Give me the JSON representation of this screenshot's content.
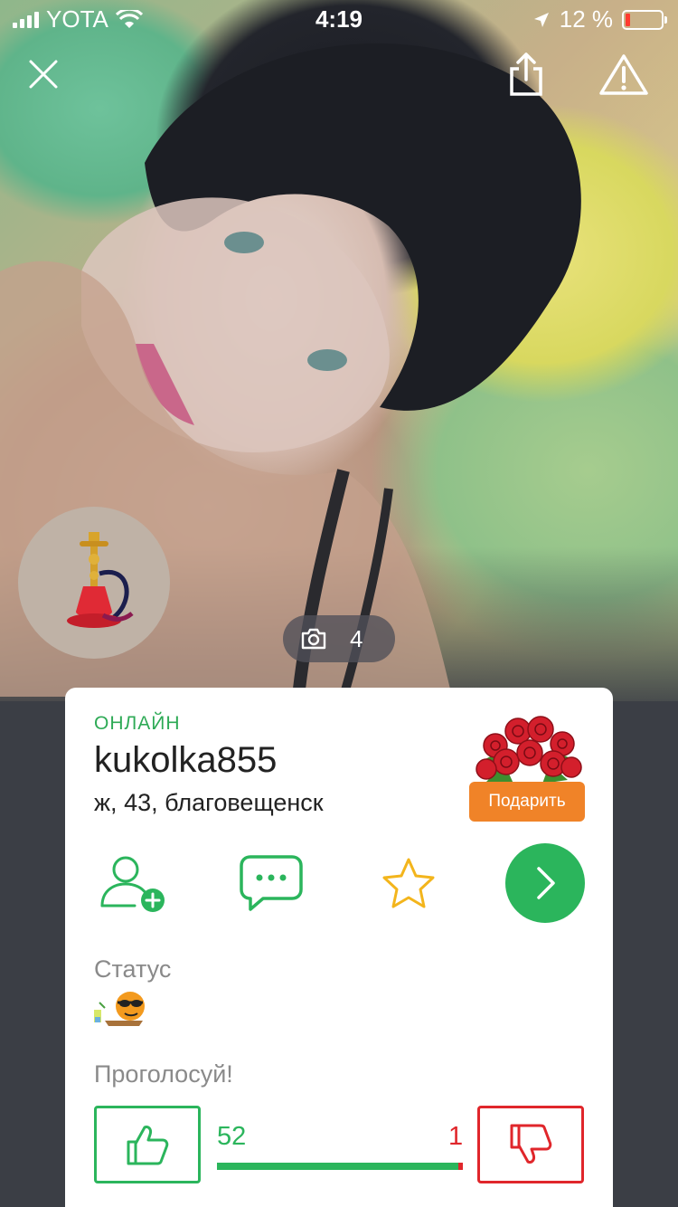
{
  "status_bar": {
    "carrier": "YOTA",
    "time": "4:19",
    "battery_percent": "12 %",
    "battery_level": 0.12
  },
  "profile": {
    "photo_count": "4",
    "online_label": "ОНЛАЙН",
    "username": "kukolka855",
    "details": "ж, 43, благовещенск",
    "gift_button": "Подарить",
    "status_label": "Статус",
    "vote_label": "Проголосуй!",
    "votes_up": "52",
    "votes_down": "1",
    "vote_ratio": 0.98
  },
  "colors": {
    "online_green": "#2eaa56",
    "action_green": "#2bb55c",
    "star_yellow": "#f3b51c",
    "vote_red": "#e0262b",
    "gift_orange": "#f08328"
  },
  "icons": {
    "close": "close-icon",
    "share": "share-icon",
    "report": "warning-icon",
    "camera": "camera-icon",
    "add_friend": "add-friend-icon",
    "message": "chat-bubble-icon",
    "favorite": "star-icon",
    "next": "chevron-right-icon",
    "like": "thumbs-up-icon",
    "dislike": "thumbs-down-icon"
  }
}
